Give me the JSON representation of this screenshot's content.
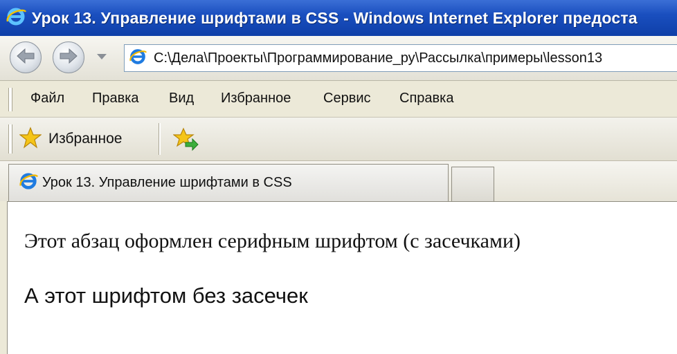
{
  "window": {
    "title": "Урок 13. Управление шрифтами в CSS - Windows Internet Explorer предоста"
  },
  "navigation": {
    "address": "C:\\Дела\\Проекты\\Программирование_ру\\Рассылка\\примеры\\lesson13"
  },
  "menu": {
    "items": [
      "Файл",
      "Правка",
      "Вид",
      "Избранное",
      "Сервис",
      "Справка"
    ]
  },
  "favorites_bar": {
    "favorites_label": "Избранное"
  },
  "tabs": [
    {
      "label": "Урок 13. Управление шрифтами в CSS",
      "active": true
    }
  ],
  "content": {
    "paragraph_serif": "Этот абзац оформлен серифным шрифтом (с засечками)",
    "paragraph_sans": "А этот шрифтом без засечек"
  },
  "icons": {
    "ie": "ie-logo-icon",
    "back": "arrow-left-icon",
    "forward": "arrow-right-icon",
    "favorites": "star-icon",
    "add_favorites": "star-add-icon"
  },
  "colors": {
    "titlebar": "#1a4fbf",
    "chrome": "#ece9d8",
    "star": "#f5c518"
  }
}
